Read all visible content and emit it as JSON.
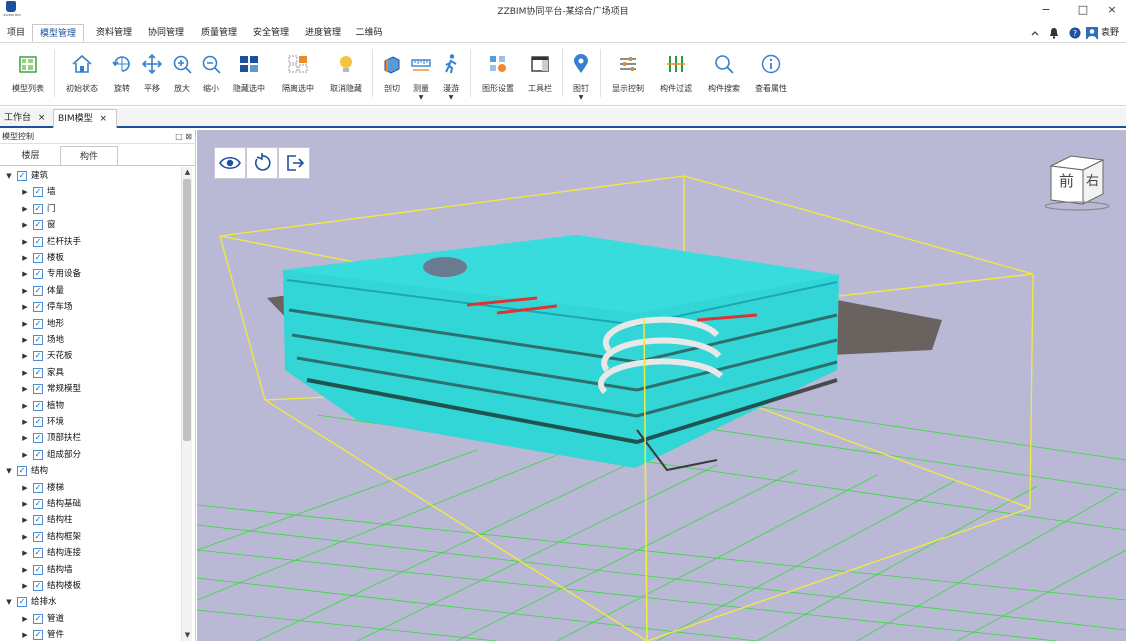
{
  "app": {
    "title": "ZZBIM协同平台-某综合广场项目",
    "logo_text": "ZzzBIM BIM",
    "user_name": "袁野"
  },
  "window_controls": {
    "minimize": "−",
    "maximize": "□",
    "close": "×"
  },
  "menu": {
    "tabs": [
      "项目",
      "模型管理",
      "资料管理",
      "协同管理",
      "质量管理",
      "安全管理",
      "进度管理",
      "二维码"
    ],
    "active_index": 1
  },
  "header_icons": [
    "chevron-up-icon",
    "bell-icon",
    "help-icon",
    "user-avatar-icon"
  ],
  "ribbon": {
    "tools": [
      {
        "label": "模型列表",
        "icon": "model-list-icon"
      },
      {
        "label": "初始状态",
        "icon": "home-icon"
      },
      {
        "label": "旋转",
        "icon": "rotate-icon"
      },
      {
        "label": "平移",
        "icon": "pan-icon"
      },
      {
        "label": "放大",
        "icon": "zoom-in-icon"
      },
      {
        "label": "缩小",
        "icon": "zoom-out-icon"
      },
      {
        "label": "隐藏选中",
        "icon": "hide-selected-icon"
      },
      {
        "label": "隔离选中",
        "icon": "isolate-selected-icon"
      },
      {
        "label": "取消隐藏",
        "icon": "unhide-icon"
      },
      {
        "label": "剖切",
        "icon": "section-icon"
      },
      {
        "label": "测量",
        "icon": "measure-icon"
      },
      {
        "label": "漫游",
        "icon": "walk-icon"
      },
      {
        "label": "图形设置",
        "icon": "graphics-settings-icon"
      },
      {
        "label": "工具栏",
        "icon": "toolbar-icon"
      },
      {
        "label": "图钉",
        "icon": "pin-icon"
      },
      {
        "label": "显示控制",
        "icon": "display-control-icon"
      },
      {
        "label": "构件过滤",
        "icon": "component-filter-icon"
      },
      {
        "label": "构件搜索",
        "icon": "component-search-icon"
      },
      {
        "label": "查看属性",
        "icon": "properties-icon"
      }
    ]
  },
  "doc_tabs": [
    {
      "label": "工作台",
      "close": "×",
      "active": false
    },
    {
      "label": "BIM模型",
      "close": "×",
      "active": true
    }
  ],
  "left_panel": {
    "title": "模型控制",
    "header_buttons": [
      "□",
      "⊠"
    ],
    "tabs": [
      "楼层",
      "构件"
    ],
    "active_tab": 1,
    "tree": [
      {
        "label": "建筑",
        "level": 0,
        "expanded": true
      },
      {
        "label": "墙",
        "level": 1
      },
      {
        "label": "门",
        "level": 1
      },
      {
        "label": "窗",
        "level": 1
      },
      {
        "label": "栏杆扶手",
        "level": 1
      },
      {
        "label": "楼板",
        "level": 1
      },
      {
        "label": "专用设备",
        "level": 1
      },
      {
        "label": "体量",
        "level": 1
      },
      {
        "label": "停车场",
        "level": 1
      },
      {
        "label": "地形",
        "level": 1
      },
      {
        "label": "场地",
        "level": 1
      },
      {
        "label": "天花板",
        "level": 1
      },
      {
        "label": "家具",
        "level": 1
      },
      {
        "label": "常规模型",
        "level": 1
      },
      {
        "label": "植物",
        "level": 1
      },
      {
        "label": "环境",
        "level": 1
      },
      {
        "label": "顶部扶栏",
        "level": 1
      },
      {
        "label": "组成部分",
        "level": 1
      },
      {
        "label": "结构",
        "level": 0,
        "expanded": true
      },
      {
        "label": "楼梯",
        "level": 1
      },
      {
        "label": "结构基础",
        "level": 1
      },
      {
        "label": "结构柱",
        "level": 1
      },
      {
        "label": "结构框架",
        "level": 1
      },
      {
        "label": "结构连接",
        "level": 1
      },
      {
        "label": "结构墙",
        "level": 1
      },
      {
        "label": "结构楼板",
        "level": 1
      },
      {
        "label": "给排水",
        "level": 0,
        "expanded": true
      },
      {
        "label": "管道",
        "level": 1
      },
      {
        "label": "管件",
        "level": 1
      }
    ]
  },
  "viewport": {
    "controls": [
      "eye-icon",
      "reset-rotate-icon",
      "exit-icon"
    ],
    "view_cube": {
      "front": "前",
      "right": "右"
    },
    "colors": {
      "background": "#b9b9d6",
      "bbox": "#f2ea3c",
      "grid": "#22dd22",
      "building": "#33d6d6"
    }
  },
  "colors": {
    "accent": "#1f4f9e",
    "check": "#1b63b8"
  }
}
